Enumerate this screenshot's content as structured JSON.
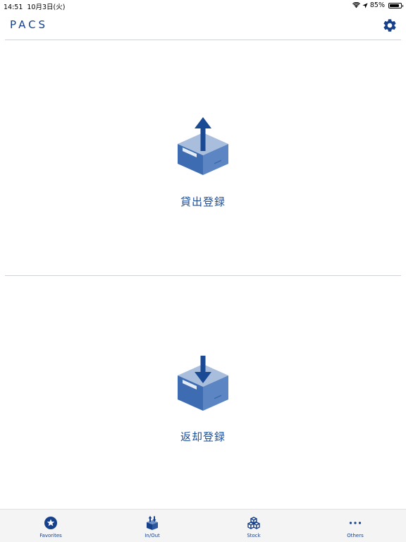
{
  "status_bar": {
    "time": "14:51",
    "date": "10月3日(火)",
    "battery": "85%",
    "battery_level": 0.85,
    "icons": [
      "wifi-icon",
      "location-icon",
      "battery-icon"
    ]
  },
  "header": {
    "logo": "PACS",
    "settings_icon": "gear-icon"
  },
  "actions": [
    {
      "label": "貸出登録",
      "icon": "box-upload-icon"
    },
    {
      "label": "返却登録",
      "icon": "box-download-icon"
    }
  ],
  "tab_bar": {
    "items": [
      {
        "label": "Favorites",
        "icon": "star-icon"
      },
      {
        "label": "In/Out",
        "icon": "box-in-out-icon"
      },
      {
        "label": "Stock",
        "icon": "stacked-boxes-icon"
      },
      {
        "label": "Others",
        "icon": "more-dots-icon"
      }
    ]
  },
  "colors": {
    "accent": "#17408A",
    "label": "#1D4F9A",
    "box_front": "#3D6CB2",
    "box_top": "#A9BEDD",
    "divider": "#CFD3D9",
    "tab_bar_bg": "#F4F4F5"
  }
}
